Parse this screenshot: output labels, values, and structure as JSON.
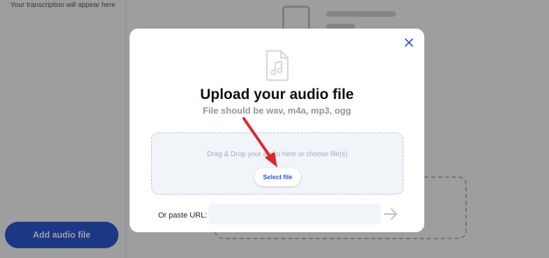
{
  "background": {
    "transcript_hint": "Your transcription will appear here",
    "add_audio_label": "Add audio file"
  },
  "modal": {
    "close_icon": "close-icon",
    "file_icon": "audio-file-icon",
    "title": "Upload your audio file",
    "subtitle": "File should be wav, m4a, mp3, ogg",
    "dropzone_text": "Drag & Drop your audio here or choose file(s)",
    "select_button": "Select file",
    "url_label": "Or paste URL:",
    "url_value": "",
    "url_placeholder": "",
    "submit_icon": "arrow-right-icon"
  },
  "colors": {
    "accent": "#2e5ad6",
    "annotation": "#e0262b",
    "subtitle": "#8a98a8"
  }
}
